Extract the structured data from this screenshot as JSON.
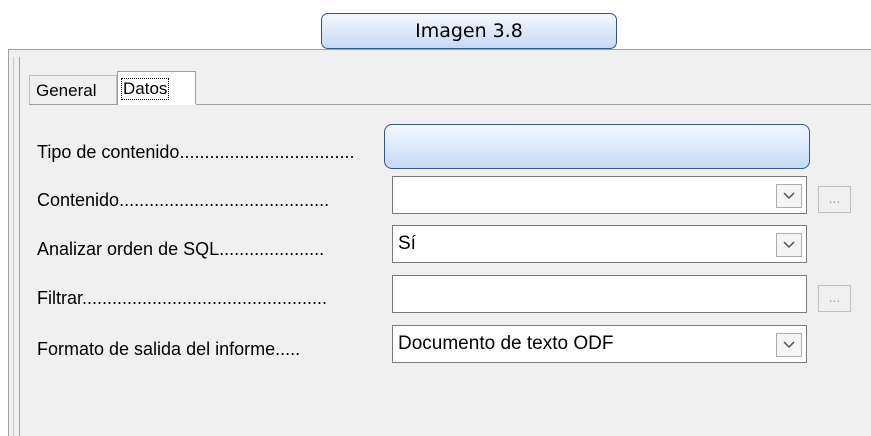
{
  "caption": {
    "text": "Imagen 3.8"
  },
  "tabs": [
    {
      "label": "General",
      "active": false
    },
    {
      "label": "Datos",
      "active": true
    }
  ],
  "rows": {
    "content_type": {
      "label": "Tipo de contenido",
      "dots": "..................................."
    },
    "content": {
      "label": "Contenido",
      "dots": "..........................................",
      "value": "",
      "has_dropdown": true,
      "has_ellipsis": true,
      "ellipsis_label": "..."
    },
    "analyze_sql": {
      "label": "Analizar orden de SQL",
      "dots": ".....................",
      "value": "Sí",
      "has_dropdown": true
    },
    "filter": {
      "label": "Filtrar",
      "dots": ".................................................",
      "value": "",
      "has_ellipsis": true,
      "ellipsis_label": "..."
    },
    "output_format": {
      "label": "Formato de salida del informe",
      "dots": ".....",
      "value": "Documento de texto ODF",
      "has_dropdown": true
    }
  },
  "icons": {
    "dropdown": "chevron-down-icon"
  },
  "colors": {
    "caption_border": "#2f5597",
    "caption_fill": "#c6d9f5",
    "panel_bg": "#f0f0f0"
  }
}
